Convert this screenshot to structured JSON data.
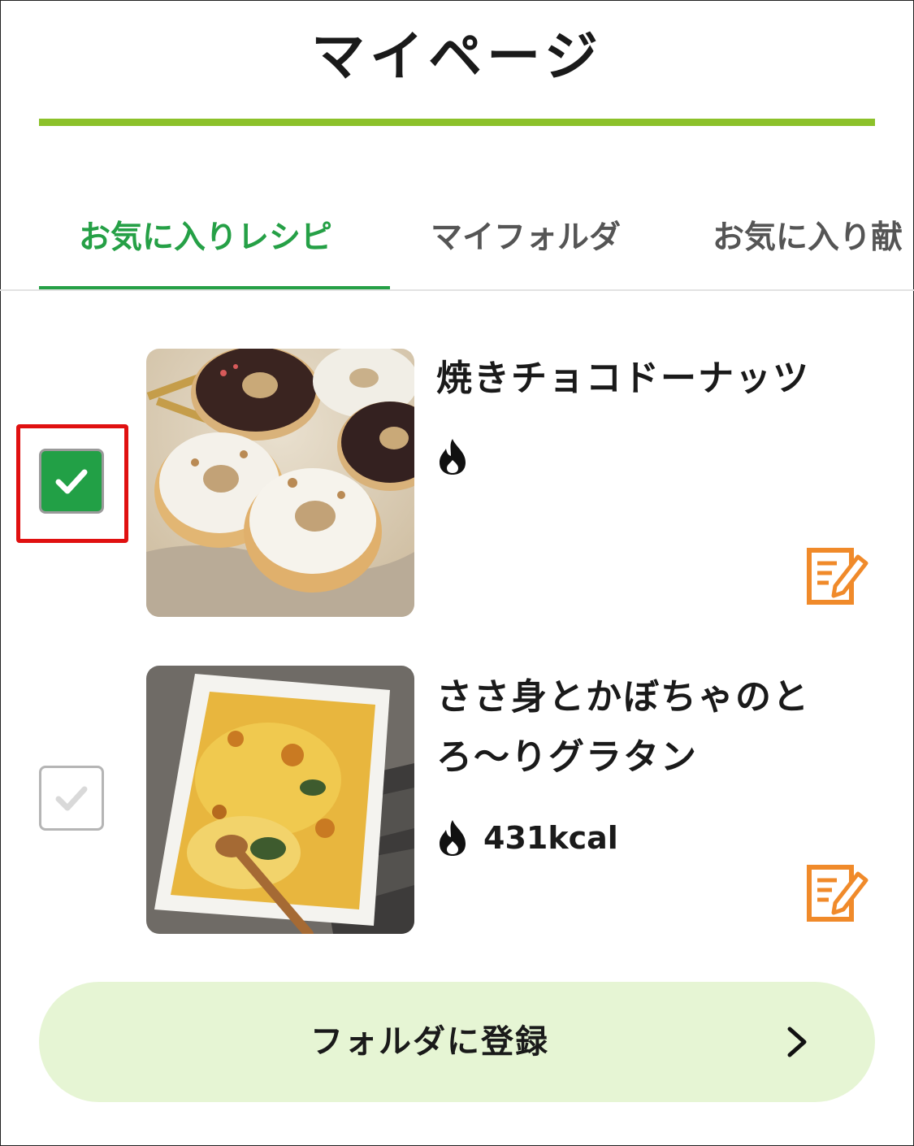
{
  "header": {
    "title": "マイページ"
  },
  "tabs": [
    {
      "label": "お気に入りレシピ",
      "active": true
    },
    {
      "label": "マイフォルダ",
      "active": false
    },
    {
      "label": "お気に入り献",
      "active": false
    }
  ],
  "recipes": [
    {
      "title": "焼きチョコドーナッツ",
      "checked": true,
      "calorie_icon": "flame-icon",
      "calorie": "",
      "image": "chocolate-donuts-photo",
      "action_icon": "memo-edit-icon"
    },
    {
      "title": "ささ身とかぼちゃのとろ〜りグラタン",
      "checked": false,
      "calorie_icon": "flame-icon",
      "calorie": "431kcal",
      "image": "chicken-pumpkin-gratin-photo",
      "action_icon": "memo-edit-icon"
    }
  ],
  "register_button": {
    "label": "フォルダに登録",
    "icon": "chevron-right-icon"
  },
  "colors": {
    "accent_green": "#25a046",
    "underline_green": "#8cc12a",
    "button_bg": "#e6f5d4",
    "memo_orange": "#f08a2a",
    "highlight_red": "#e01010"
  }
}
